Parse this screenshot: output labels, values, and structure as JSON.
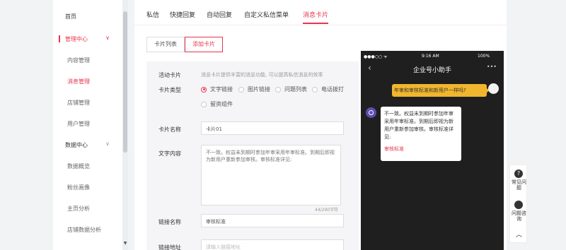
{
  "sidebar": {
    "items": [
      {
        "label": "首页"
      },
      {
        "label": "管理中心"
      },
      {
        "label": "内容管理"
      },
      {
        "label": "消息管理"
      },
      {
        "label": "店铺管理"
      },
      {
        "label": "用户管理"
      },
      {
        "label": "数据中心"
      },
      {
        "label": "数据概览"
      },
      {
        "label": "粉丝画像"
      },
      {
        "label": "主页分析"
      },
      {
        "label": "店铺数据分析"
      }
    ]
  },
  "tabs": [
    "私信",
    "快捷回复",
    "自动回复",
    "自定义私信菜单",
    "消息卡片"
  ],
  "sub_tabs": [
    "卡片列表",
    "添加卡片"
  ],
  "form": {
    "activity_label": "活动卡片",
    "activity_note": "消息卡片提供丰富的消息功能, 可以提高私信消息的效率",
    "type_label": "卡片类型",
    "type_options": [
      "文字链接",
      "图片链接",
      "问题列表",
      "电话拨打",
      "留资组件"
    ],
    "name_label": "卡片名称",
    "name_value": "卡片01",
    "text_label": "文字内容",
    "text_value": "不一致。权益未到期时参加年审采用年审标准。到期后即视为新用户重新参加审核。审核标准详见:",
    "text_count": "44/290字符",
    "link_name_label": "链接名称",
    "link_name_value": "审核标准",
    "link_url_label": "链接地址",
    "link_url_placeholder": "请输入链接地址"
  },
  "phone": {
    "status_left": "●●●○○ ᯤ",
    "status_time": "9:16 AM",
    "status_battery": "100%",
    "title": "企业号小助手",
    "more": "•••",
    "user_message": "年审和审核标准和新用户一样吗?",
    "card_text": "不一致。权益未到期时参加年审采用年审标准。到期后即视为新用户重新参加审核。审核标准详见:",
    "card_link": "审核标准"
  },
  "float_panel": {
    "help_icon": "?",
    "help_label": "常见问题",
    "consult_label": "问题咨询"
  },
  "colors": {
    "accent": "#e8344e",
    "bubble": "#f1b62e"
  }
}
